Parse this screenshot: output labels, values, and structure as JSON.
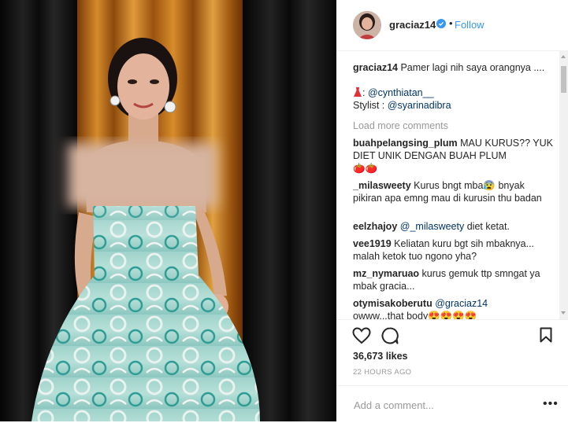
{
  "post": {
    "username": "graciaz14",
    "follow_label": "Follow",
    "separator": "•"
  },
  "caption": {
    "username": "graciaz14",
    "text": "Pamer lagi nih saya orangnya ....",
    "line2_emoji_label": "dress-emoji",
    "line2_prefix": ": ",
    "line2_mention": "@cynthiatan__",
    "line3_prefix": "Stylist : ",
    "line3_mention": "@syarinadibra"
  },
  "load_more_label": "Load more comments",
  "comments": [
    {
      "username": "buahpelangsing_plum",
      "text": "MAU KURUS?? YUK DIET UNIK DENGAN BUAH PLUM",
      "suffix_emoji": "🍅🍅"
    },
    {
      "username": "_milasweety",
      "text": "Kurus bngt mba",
      "emoji": "😰",
      "text2": "bnyak pikiran apa emng mau di kurusin thu badan"
    },
    {
      "username": "eelzhajoy",
      "mention": "@_milasweety",
      "text": "diet ketat."
    },
    {
      "username": "vee1919",
      "text": "Keliatan kuru bgt sih mbaknya... malah ketok tuo ngono yha?"
    },
    {
      "username": "mz_nymaruao",
      "text": "kurus gemuk ttp smngat ya mbak gracia..."
    },
    {
      "username": "otymisakoberutu",
      "mention": "@graciaz14",
      "text": "owww...that body",
      "suffix_emoji": "😍😍😍😍"
    }
  ],
  "likes_text": "36,673 likes",
  "timestamp": "22 HOURS AGO",
  "comment_input": {
    "placeholder": "Add a comment...",
    "value": ""
  },
  "more_options_label": "•••",
  "colors": {
    "link_blue": "#3897f0",
    "mention_blue": "#003569",
    "muted_gray": "#999999",
    "text": "#262626",
    "border": "#efefef",
    "curtain_orange": "#c8781a",
    "dress_mint": "#a7d8d0"
  }
}
